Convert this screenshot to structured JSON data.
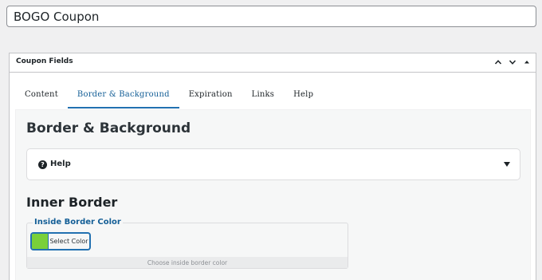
{
  "post_title": {
    "value": "BOGO Coupon"
  },
  "metabox": {
    "title": "Coupon Fields",
    "actions": [
      "chevron-up-icon",
      "chevron-down-icon",
      "caret-up-icon"
    ]
  },
  "tabs": [
    {
      "label": "Content",
      "active": false
    },
    {
      "label": "Border & Background",
      "active": true
    },
    {
      "label": "Expiration",
      "active": false
    },
    {
      "label": "Links",
      "active": false
    },
    {
      "label": "Help",
      "active": false
    }
  ],
  "panel": {
    "heading": "Border & Background",
    "help": {
      "label": "Help",
      "icon": "question-circle-icon"
    },
    "section_heading": "Inner Border",
    "field": {
      "legend": "Inside Border Color",
      "button_label": "Select Color",
      "swatch_color": "#7ad03a",
      "description": "Choose inside border color"
    }
  }
}
